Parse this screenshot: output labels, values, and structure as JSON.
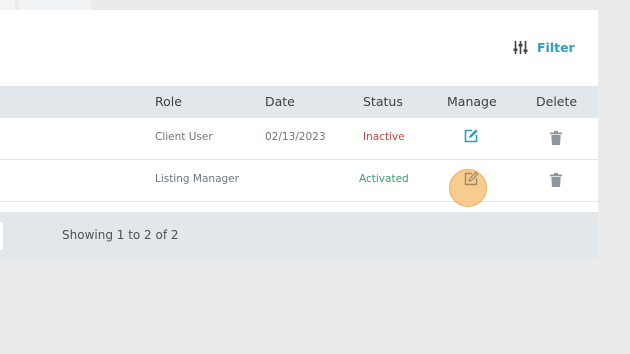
{
  "toolbar": {
    "filter_label": "Filter"
  },
  "table": {
    "headers": {
      "role": "Role",
      "date": "Date",
      "status": "Status",
      "manage": "Manage",
      "delete": "Delete"
    },
    "rows": [
      {
        "role": "Client User",
        "date": "02/13/2023",
        "status": "Inactive"
      },
      {
        "role": "Listing Manager",
        "date": "",
        "status": "Activated"
      }
    ]
  },
  "footer": {
    "showing_text": "Showing 1 to 2 of 2"
  },
  "icons": {
    "filter": "sliders-icon",
    "manage": "edit-icon",
    "delete": "trash-icon"
  },
  "colors": {
    "accent": "#2a9fc9",
    "inactive": "#c2483f",
    "active": "#3c9a68",
    "header_bg": "#e1e7ea",
    "highlight": "#f6be6e"
  }
}
